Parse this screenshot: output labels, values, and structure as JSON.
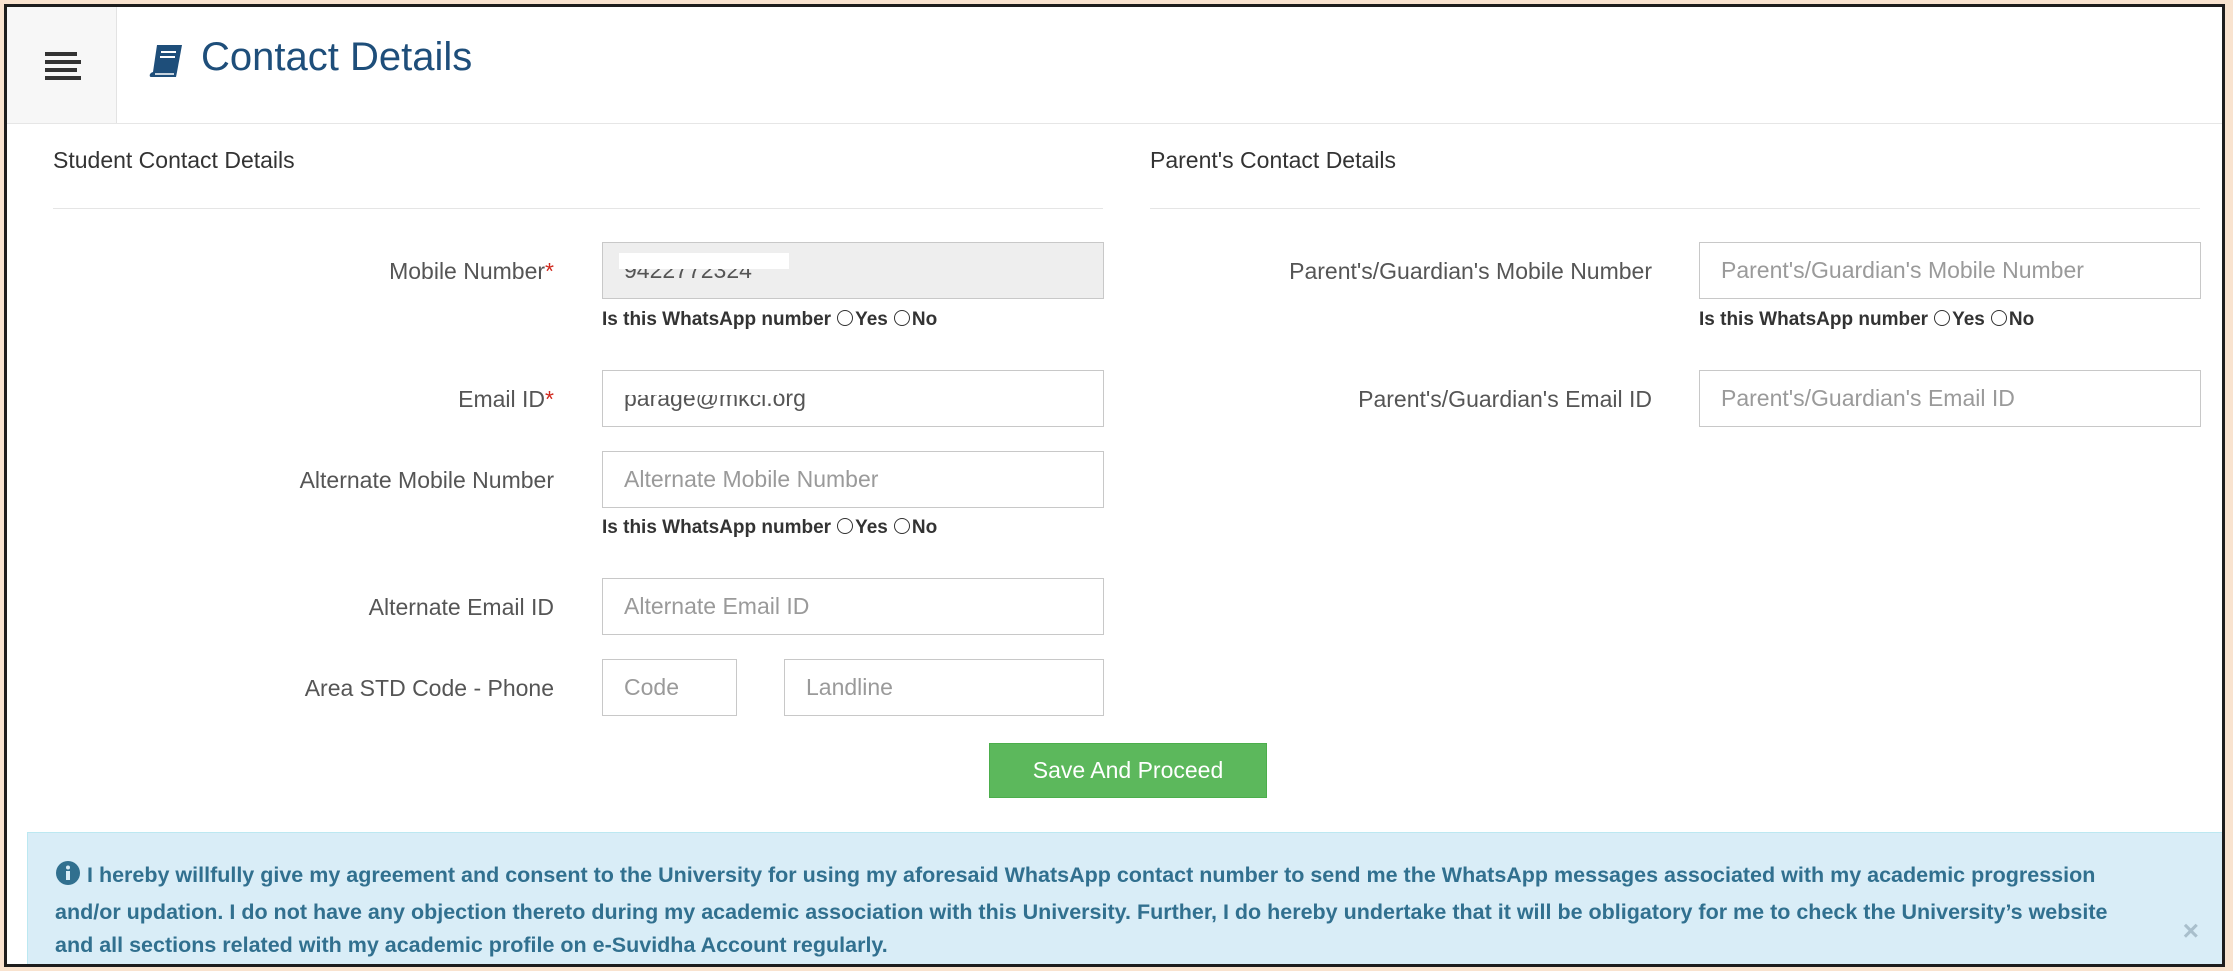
{
  "header": {
    "title": "Contact Details"
  },
  "student": {
    "section_title": "Student Contact Details",
    "mobile": {
      "label": "Mobile Number",
      "value": "9422772324"
    },
    "email": {
      "label": "Email ID",
      "value": "parage@mkcl.org"
    },
    "alt_mobile": {
      "label": "Alternate Mobile Number",
      "placeholder": "Alternate Mobile Number"
    },
    "alt_email": {
      "label": "Alternate Email ID",
      "placeholder": "Alternate Email ID"
    },
    "phone": {
      "label": "Area STD Code - Phone",
      "code_placeholder": "Code",
      "landline_placeholder": "Landline"
    }
  },
  "parent": {
    "section_title": "Parent's Contact Details",
    "mobile": {
      "label": "Parent's/Guardian's Mobile Number",
      "placeholder": "Parent's/Guardian's Mobile Number"
    },
    "email": {
      "label": "Parent's/Guardian's Email ID",
      "placeholder": "Parent's/Guardian's Email ID"
    }
  },
  "whatsapp": {
    "question": "Is this WhatsApp number",
    "yes": "Yes",
    "no": "No"
  },
  "required_mark": "*",
  "save_button": "Save And Proceed",
  "consent": {
    "text": "I hereby willfully give my agreement and consent to the University for using my aforesaid WhatsApp contact number to send me the WhatsApp messages associated with my academic progression and/or updation. I do not have any objection thereto during my academic association with this University. Further, I do hereby undertake that it will be obligatory for me to check the University’s website and all sections related with my academic profile on e-Suvidha Account regularly.",
    "close": "×"
  },
  "colors": {
    "title": "#1e4e7a",
    "required": "#d0291e",
    "button": "#5cb85c",
    "alert_bg": "#d9edf7",
    "alert_text": "#31708f"
  },
  "icons": {
    "menu": "menu-icon",
    "title": "book-icon",
    "info": "info-circle-icon",
    "close": "close-icon"
  }
}
